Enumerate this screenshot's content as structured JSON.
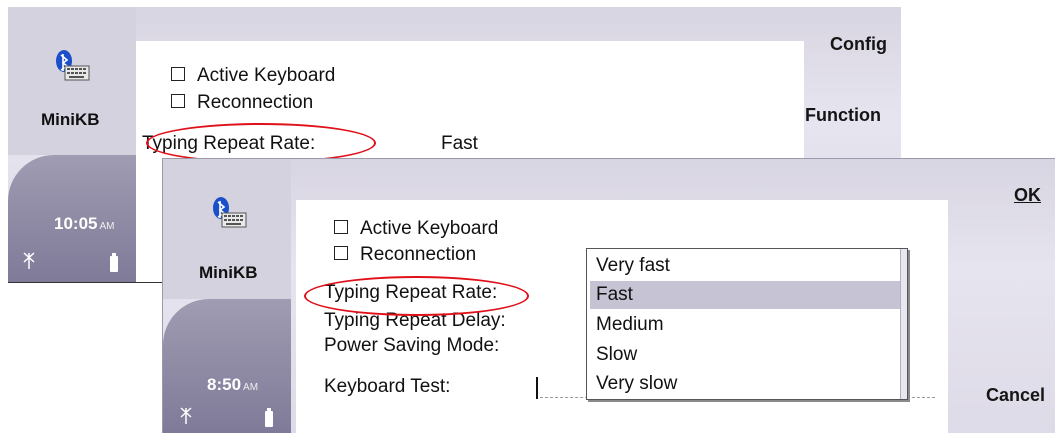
{
  "screen1": {
    "app_name": "MiniKB",
    "clock_time": "10:05",
    "clock_ampm": "AM",
    "softkeys": {
      "top": "Config",
      "middle": "Function"
    },
    "checkboxes": [
      {
        "label": "Active Keyboard",
        "checked": false
      },
      {
        "label": "Reconnection",
        "checked": false
      }
    ],
    "repeat_rate_label": "Typing Repeat Rate:",
    "repeat_rate_value": "Fast"
  },
  "screen2": {
    "app_name": "MiniKB",
    "clock_time": "8:50",
    "clock_ampm": "AM",
    "softkeys": {
      "top": "OK",
      "bottom": "Cancel"
    },
    "checkboxes": [
      {
        "label": "Active Keyboard",
        "checked": false
      },
      {
        "label": "Reconnection",
        "checked": false
      }
    ],
    "fields": {
      "repeat_rate": "Typing Repeat Rate:",
      "repeat_delay": "Typing Repeat Delay:",
      "power_saving": "Power Saving Mode:",
      "keyboard_test": "Keyboard Test:"
    },
    "dropdown": {
      "selected": "Fast",
      "options": [
        "Very fast",
        "Fast",
        "Medium",
        "Slow",
        "Very slow"
      ]
    }
  },
  "colors": {
    "highlight_oval": "#e0101a",
    "selected_option": "#c5c3d4",
    "sidebar": "#8a85a2"
  },
  "icons": [
    "bluetooth-keyboard-icon",
    "signal-icon",
    "battery-icon"
  ]
}
